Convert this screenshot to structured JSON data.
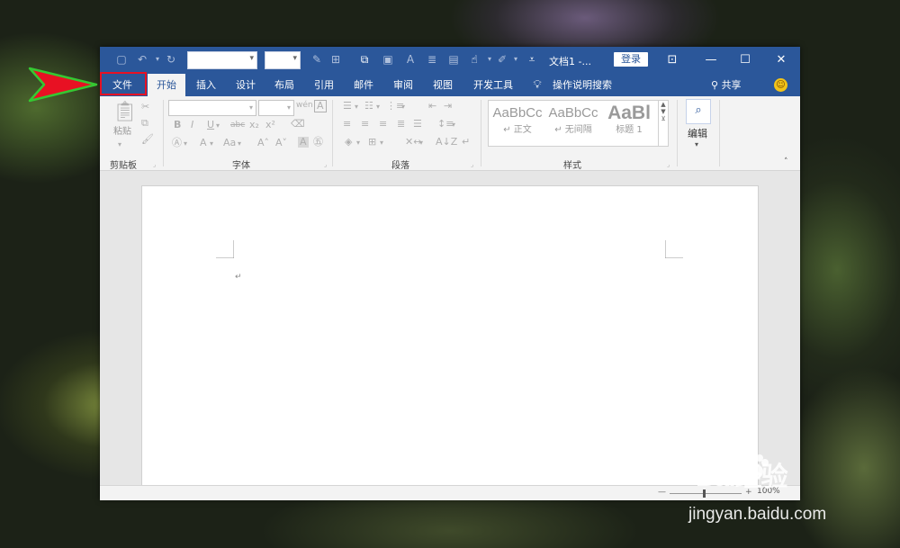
{
  "window": {
    "doc_title": "文档1 -...",
    "login": "登录",
    "controls": [
      "ribbon-display-icon",
      "minimize-icon",
      "maximize-icon",
      "close-icon"
    ]
  },
  "tabs": [
    {
      "label": "文件",
      "active": false
    },
    {
      "label": "开始",
      "active": true
    },
    {
      "label": "插入",
      "active": false
    },
    {
      "label": "设计",
      "active": false
    },
    {
      "label": "布局",
      "active": false
    },
    {
      "label": "引用",
      "active": false
    },
    {
      "label": "邮件",
      "active": false
    },
    {
      "label": "审阅",
      "active": false
    },
    {
      "label": "视图",
      "active": false
    },
    {
      "label": "开发工具",
      "active": false
    }
  ],
  "tell_me": "操作说明搜索",
  "share": "共享",
  "ribbon": {
    "clipboard": {
      "paste": "粘贴",
      "label": "剪贴板"
    },
    "font": {
      "label": "字体",
      "bold": "B",
      "italic": "I",
      "underline": "U",
      "strike": "abc",
      "sub": "x₂",
      "sup": "x²",
      "font_size_a": "A",
      "aa": "Aa"
    },
    "paragraph": {
      "label": "段落"
    },
    "styles": {
      "label": "样式",
      "items": [
        {
          "preview": "AaBbCc",
          "name": "↵ 正文"
        },
        {
          "preview": "AaBbCc",
          "name": "↵ 无间隔"
        },
        {
          "preview": "AaBl",
          "name": "标题 1"
        }
      ]
    },
    "editing": {
      "label": "编辑"
    }
  },
  "status": {
    "zoom": "100%"
  },
  "annotations": {
    "highlight_color": "#e81123",
    "arrow_color": "#e81123"
  },
  "watermark": {
    "brand": "Bai经验",
    "url": "jingyan.baidu.com"
  },
  "colors": {
    "title_bar": "#2b579a",
    "ribbon": "#f3f3f3"
  }
}
